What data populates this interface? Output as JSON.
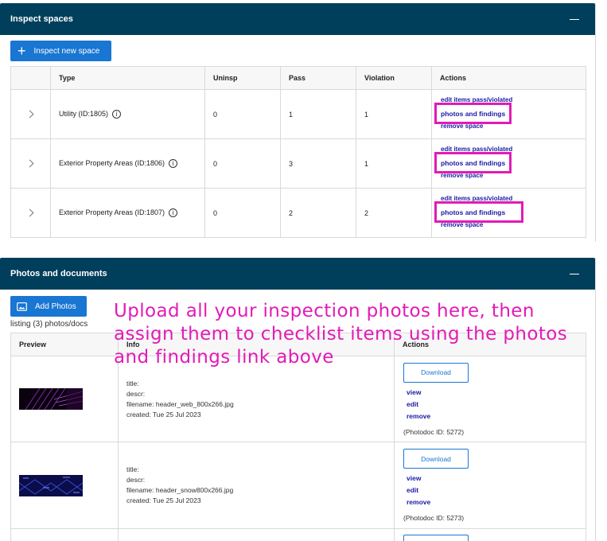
{
  "inspect_panel": {
    "title": "Inspect spaces",
    "collapse_label": "—",
    "new_button_label": "Inspect new space",
    "columns": [
      "",
      "Type",
      "Uninsp",
      "Pass",
      "Violation",
      "Actions"
    ],
    "rows": [
      {
        "type": "Utility (ID:1805)",
        "uninsp": "0",
        "pass": "1",
        "violation": "1"
      },
      {
        "type": "Exterior Property Areas (ID:1806)",
        "uninsp": "0",
        "pass": "3",
        "violation": "1"
      },
      {
        "type": "Exterior Property Areas (ID:1807)",
        "uninsp": "0",
        "pass": "2",
        "violation": "2"
      }
    ],
    "action_labels": {
      "edit": "edit items pass/violated",
      "photos": "photos and findings",
      "remove": "remove space"
    },
    "highlight_color": "#e21bb6"
  },
  "photos_panel": {
    "title": "Photos and documents",
    "add_button_label": "Add Photos",
    "listing_text": "listing (3) photos/docs",
    "columns": [
      "Preview",
      "Info",
      "Actions"
    ],
    "download_label": "Download",
    "link_labels": {
      "view": "view",
      "edit": "edit",
      "remove": "remove"
    },
    "rows": [
      {
        "title_line": "title:",
        "descr_line": "descr:",
        "filename_line": "filename: header_web_800x266.jpg",
        "created_line": "created: Tue 25 Jul 2023",
        "photodoc_id": "(Photodoc ID: 5272)"
      },
      {
        "title_line": "title:",
        "descr_line": "descr:",
        "filename_line": "filename: header_snow800x266.jpg",
        "created_line": "created: Tue 25 Jul 2023",
        "photodoc_id": "(Photodoc ID: 5273)"
      }
    ]
  },
  "annotation": {
    "text": "Upload all your inspection photos here, then assign them to checklist items using the photos and findings link above",
    "color": "#e21bb6"
  },
  "colors": {
    "header_bg": "#003f5c",
    "primary": "#1976d2",
    "link": "#1a1aa6"
  }
}
